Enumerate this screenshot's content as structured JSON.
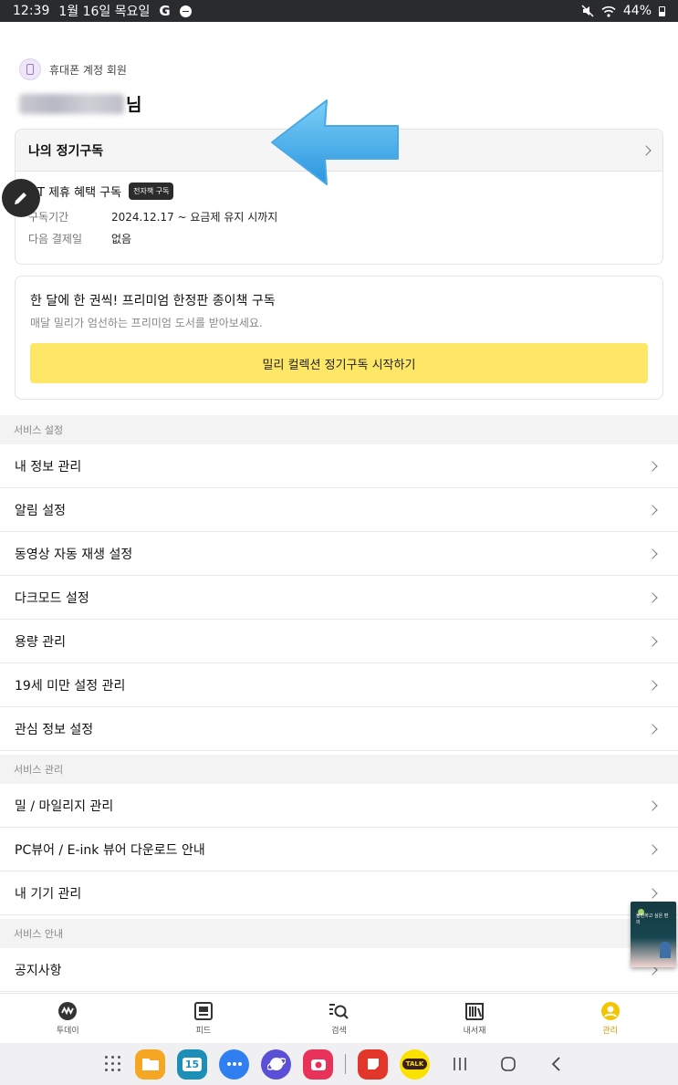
{
  "status_bar": {
    "time": "12:39",
    "date": "1월 16일 목요일",
    "g_label": "G",
    "battery": "44%"
  },
  "account": {
    "type_label": "휴대폰 계정 회원",
    "name_suffix": "님"
  },
  "subscription": {
    "title": "나의 정기구독",
    "plan_name": "T 제휴 혜택 구독",
    "plan_tag": "전자책 구독",
    "period_label": "구독기간",
    "period_value": "2024.12.17 ~ 요금제 유지 시까지",
    "next_payment_label": "다음 결제일",
    "next_payment_value": "없음"
  },
  "promo": {
    "title": "한 달에 한 권씩! 프리미엄 한정판 종이책 구독",
    "subtitle": "매달 밀리가 엄선하는 프리미엄 도서를 받아보세요.",
    "button": "밀리 컬렉션 정기구독 시작하기"
  },
  "sections": {
    "service_settings": "서비스 설정",
    "service_management": "서비스 관리",
    "service_info": "서비스 안내"
  },
  "settings_items": [
    "내 정보 관리",
    "알림 설정",
    "동영상 자동 재생 설정",
    "다크모드 설정",
    "용량 관리",
    "19세 미만 설정 관리",
    "관심 정보 설정"
  ],
  "management_items": [
    "밀 / 마일리지 관리",
    "PC뷰어 / E-ink 뷰어 다운로드 안내",
    "내 기기 관리"
  ],
  "info_items": [
    "공지사항"
  ],
  "floating_book": {
    "title": "불편하고 싶은 편의"
  },
  "tabs": [
    {
      "label": "투데이",
      "icon": "today-icon"
    },
    {
      "label": "피드",
      "icon": "feed-icon"
    },
    {
      "label": "검색",
      "icon": "search-icon"
    },
    {
      "label": "내서재",
      "icon": "library-icon"
    },
    {
      "label": "관리",
      "icon": "profile-icon",
      "active": true
    }
  ],
  "dock": {
    "calendar_day": "15",
    "kakaotalk": "TALK"
  },
  "colors": {
    "accent_yellow": "#fee666",
    "active_tab": "#c69a00",
    "arrow_blue": "#3aa8e8"
  }
}
